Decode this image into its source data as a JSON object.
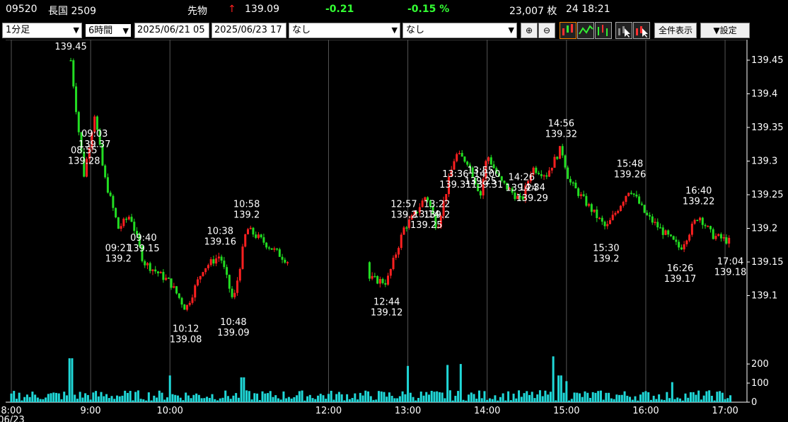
{
  "header": {
    "code": "09520",
    "name": "長国 2509",
    "category": "先物",
    "arrow": "↑",
    "price": "139.09",
    "change": "-0.21",
    "change_pct": "-0.15 %",
    "volume": "23,007 枚",
    "time": "24 18:21"
  },
  "toolbar": {
    "interval": "1分足",
    "span": "6時間",
    "start": "2025/06/21 05",
    "end": "2025/06/23 17",
    "indicator1": "なし",
    "indicator2": "なし",
    "zoom_in_icon": "zoom-in-icon",
    "zoom_out_icon": "zoom-out-icon",
    "show_all": "全件表示",
    "settings": "▼設定"
  },
  "colors": {
    "up": "#ff2020",
    "down": "#22dd22",
    "volume": "#20d8d8",
    "grid": "#555555",
    "axis": "#ffffff"
  },
  "chart_data": {
    "type": "candlestick",
    "price_ticks": [
      139.1,
      139.15,
      139.2,
      139.25,
      139.3,
      139.35,
      139.4,
      139.45
    ],
    "volume_ticks": [
      0,
      100,
      200
    ],
    "time_labels": [
      "8:00",
      "9:00",
      "10:00",
      "12:00",
      "13:00",
      "14:00",
      "15:00",
      "16:00",
      "17:00"
    ],
    "date_label": "06/23",
    "price_path": [
      [
        "08:45",
        139.45
      ],
      [
        "08:50",
        139.36
      ],
      [
        "08:55",
        139.28
      ],
      [
        "09:03",
        139.37
      ],
      [
        "09:10",
        139.28
      ],
      [
        "09:21",
        139.2
      ],
      [
        "09:30",
        139.22
      ],
      [
        "09:40",
        139.15
      ],
      [
        "10:00",
        139.12
      ],
      [
        "10:12",
        139.08
      ],
      [
        "10:25",
        139.14
      ],
      [
        "10:38",
        139.16
      ],
      [
        "10:48",
        139.09
      ],
      [
        "10:58",
        139.2
      ],
      [
        "11:30",
        139.15
      ],
      [
        "12:44",
        139.12
      ],
      [
        "12:57",
        139.2
      ],
      [
        "13:05",
        139.22
      ],
      [
        "13:14",
        139.25
      ],
      [
        "13:22",
        139.2
      ],
      [
        "13:36",
        139.31
      ],
      [
        "13:45",
        139.3
      ],
      [
        "13:55",
        139.25
      ],
      [
        "14:00",
        139.31
      ],
      [
        "14:10",
        139.27
      ],
      [
        "14:26",
        139.24
      ],
      [
        "14:34",
        139.29
      ],
      [
        "14:45",
        139.28
      ],
      [
        "14:56",
        139.32
      ],
      [
        "15:02",
        139.27
      ],
      [
        "15:30",
        139.2
      ],
      [
        "15:48",
        139.26
      ],
      [
        "16:00",
        139.22
      ],
      [
        "16:26",
        139.17
      ],
      [
        "16:40",
        139.22
      ],
      [
        "16:50",
        139.19
      ],
      [
        "17:04",
        139.18
      ]
    ],
    "annotations": [
      {
        "time": "08:45",
        "value": "139.45"
      },
      {
        "time": "09:03",
        "value": "139.37"
      },
      {
        "time": "08:55",
        "value": "139.28"
      },
      {
        "time": "09:21",
        "value": "139.2"
      },
      {
        "time": "09:40",
        "value": "139.15"
      },
      {
        "time": "10:12",
        "value": "139.08"
      },
      {
        "time": "10:38",
        "value": "139.16"
      },
      {
        "time": "10:48",
        "value": "139.09"
      },
      {
        "time": "10:58",
        "value": "139.2"
      },
      {
        "time": "12:44",
        "value": "139.12"
      },
      {
        "time": "12:57",
        "value": "139.2"
      },
      {
        "time": "13:14",
        "value": "139.25"
      },
      {
        "time": "13:22",
        "value": "139.2"
      },
      {
        "time": "13:36",
        "value": "139.31"
      },
      {
        "time": "13:55",
        "value": "139.25"
      },
      {
        "time": "14:00",
        "value": "139.31"
      },
      {
        "time": "14:26",
        "value": "139.24"
      },
      {
        "time": "14:34",
        "value": "139.29"
      },
      {
        "time": "14:56",
        "value": "139.32"
      },
      {
        "time": "15:30",
        "value": "139.2"
      },
      {
        "time": "15:48",
        "value": "139.26"
      },
      {
        "time": "16:26",
        "value": "139.17"
      },
      {
        "time": "16:40",
        "value": "139.22"
      },
      {
        "time": "17:04",
        "value": "139.18"
      }
    ],
    "volume_spikes": [
      [
        "08:45",
        230
      ],
      [
        "10:00",
        140
      ],
      [
        "10:55",
        130
      ],
      [
        "13:00",
        190
      ],
      [
        "13:30",
        195
      ],
      [
        "13:40",
        200
      ],
      [
        "14:50",
        240
      ],
      [
        "14:55",
        140
      ],
      [
        "15:00",
        110
      ],
      [
        "16:20",
        105
      ]
    ],
    "ylim": [
      139.07,
      139.47
    ]
  }
}
